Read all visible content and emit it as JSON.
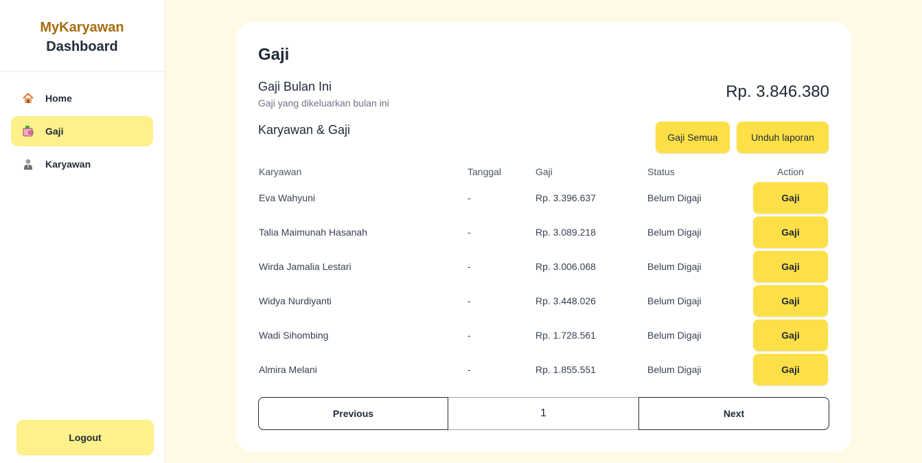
{
  "sidebar": {
    "brand_name": "MyKaryawan",
    "brand_sub": "Dashboard",
    "items": [
      {
        "label": "Home",
        "icon": "home-icon"
      },
      {
        "label": "Gaji",
        "icon": "wallet-icon"
      },
      {
        "label": "Karyawan",
        "icon": "employee-icon"
      }
    ],
    "active": "Gaji",
    "logout_label": "Logout"
  },
  "main": {
    "title": "Gaji",
    "summary": {
      "title": "Gaji Bulan Ini",
      "subtitle": "Gaji yang dikeluarkan bulan ini",
      "total": "Rp. 3.846.380"
    },
    "section_title": "Karyawan & Gaji",
    "buttons": {
      "pay_all": "Gaji Semua",
      "download": "Unduh laporan"
    },
    "table": {
      "headers": [
        "Karyawan",
        "Tanggal",
        "Gaji",
        "Status",
        "Action"
      ],
      "rows": [
        {
          "name": "Eva Wahyuni",
          "date": "-",
          "salary": "Rp. 3.396.637",
          "status": "Belum Digaji",
          "action": "Gaji"
        },
        {
          "name": "Talia Maimunah Hasanah",
          "date": "-",
          "salary": "Rp. 3.089.218",
          "status": "Belum Digaji",
          "action": "Gaji"
        },
        {
          "name": "Wirda Jamalia Lestari",
          "date": "-",
          "salary": "Rp. 3.006.068",
          "status": "Belum Digaji",
          "action": "Gaji"
        },
        {
          "name": "Widya Nurdiyanti",
          "date": "-",
          "salary": "Rp. 3.448.026",
          "status": "Belum Digaji",
          "action": "Gaji"
        },
        {
          "name": "Wadi Sihombing",
          "date": "-",
          "salary": "Rp. 1.728.561",
          "status": "Belum Digaji",
          "action": "Gaji"
        },
        {
          "name": "Almira Melani",
          "date": "-",
          "salary": "Rp. 1.855.551",
          "status": "Belum Digaji",
          "action": "Gaji"
        }
      ]
    },
    "pagination": {
      "previous": "Previous",
      "page": "1",
      "next": "Next"
    }
  },
  "colors": {
    "accent": "#fde047",
    "accent_light": "#fef08a",
    "brand": "#a86b0c",
    "background": "#fefae6"
  }
}
